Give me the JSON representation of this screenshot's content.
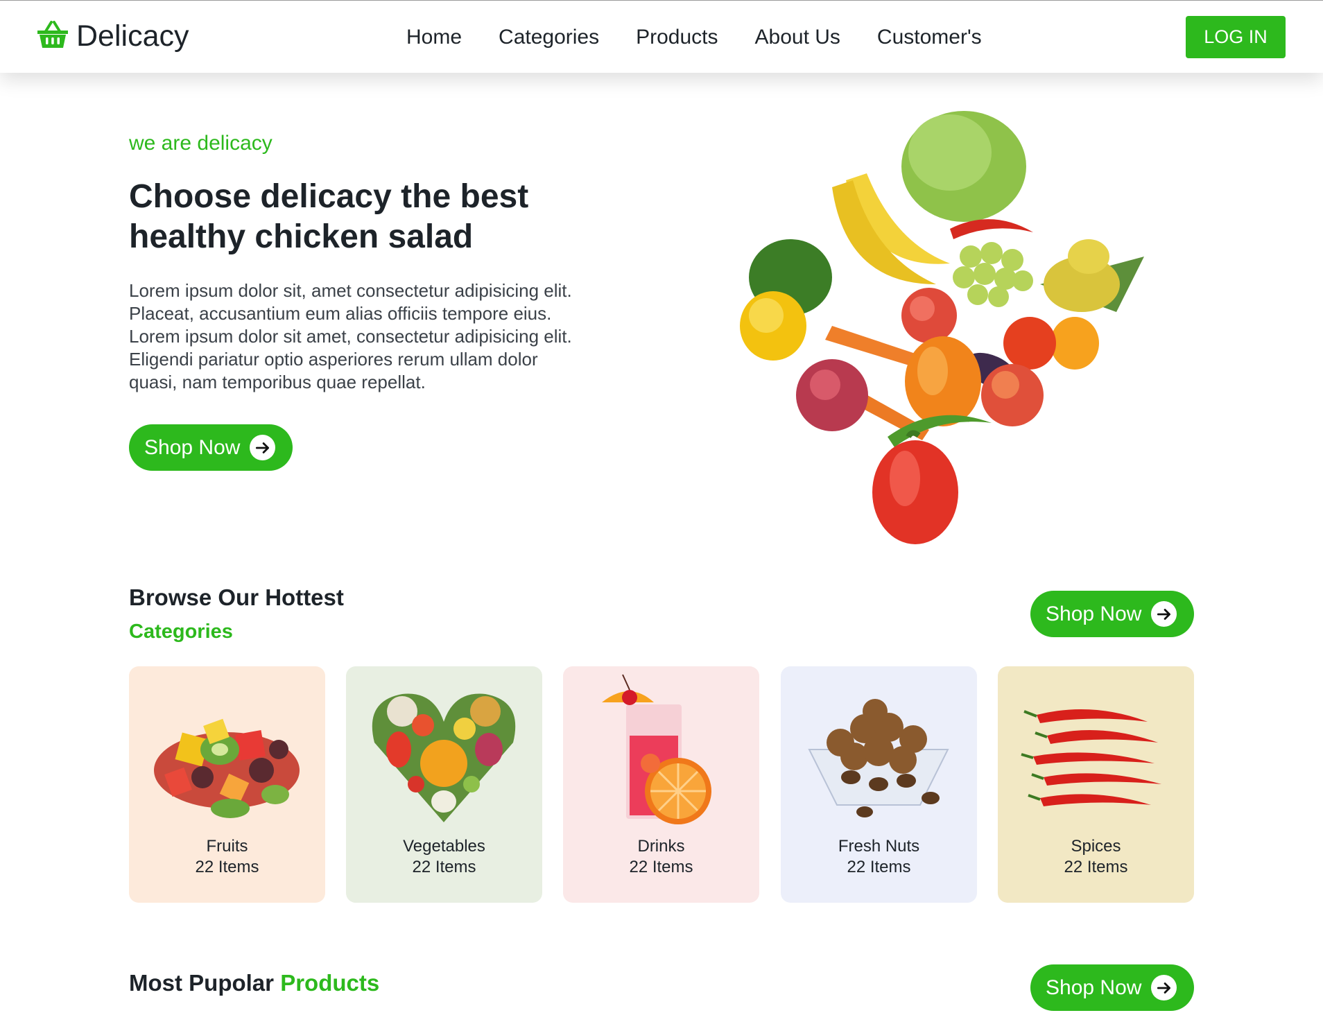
{
  "nav": {
    "brand": "Delicacy",
    "links": [
      "Home",
      "Categories",
      "Products",
      "About Us",
      "Customer's"
    ],
    "login_label": "LOG IN"
  },
  "hero": {
    "eyebrow": "we are delicacy",
    "title_line1": "Choose delicacy the best",
    "title_line2": "healthy chicken salad",
    "description_lines": [
      "Lorem ipsum dolor sit, amet consectetur adipisicing elit.",
      "Placeat, accusantium eum alias officiis tempore eius.",
      "Lorem ipsum dolor sit amet, consectetur adipisicing elit.",
      "Eligendi pariatur optio asperiores rerum ullam dolor",
      "quasi, nam temporibus quae repellat."
    ],
    "cta_label": "Shop Now",
    "image_icon": "vegetables-pile-image"
  },
  "categories_section": {
    "title": "Browse Our Hottest",
    "subtitle": "Categories",
    "cta_label": "Shop Now",
    "items": [
      {
        "name": "Fruits",
        "count": "22 Items",
        "bg": "#fdeadb",
        "icon": "fruit-salad-image"
      },
      {
        "name": "Vegetables",
        "count": "22 Items",
        "bg": "#e8efe2",
        "icon": "vegetable-heart-image"
      },
      {
        "name": "Drinks",
        "count": "22 Items",
        "bg": "#fbe8e8",
        "icon": "juice-glass-image"
      },
      {
        "name": "Fresh Nuts",
        "count": "22 Items",
        "bg": "#eceffa",
        "icon": "nut-bowl-image"
      },
      {
        "name": "Spices",
        "count": "22 Items",
        "bg": "#f2e8c4",
        "icon": "chili-peppers-image"
      }
    ]
  },
  "products_section": {
    "title_part1": "Most Pupolar",
    "title_part2": "Products",
    "cta_label": "Shop Now"
  },
  "colors": {
    "accent": "#2db91d",
    "text": "#1d2329"
  }
}
